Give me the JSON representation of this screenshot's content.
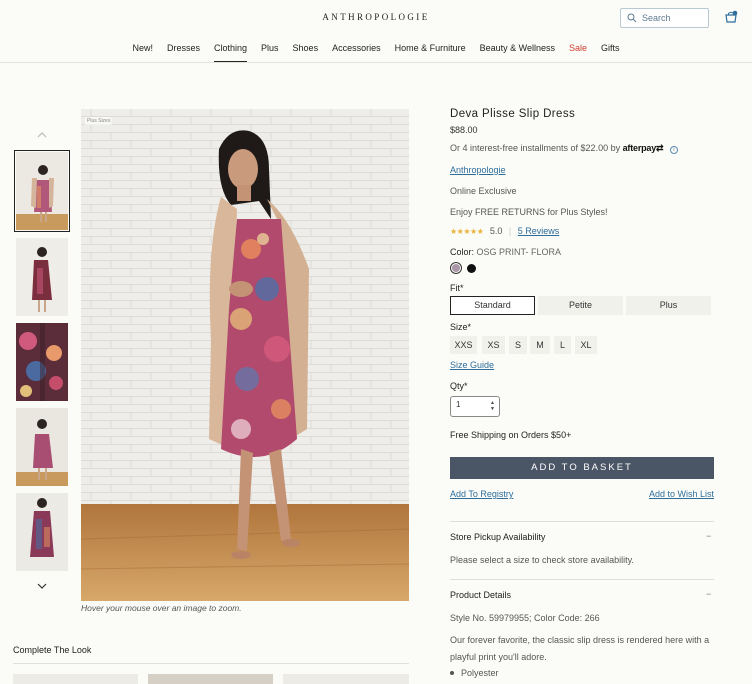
{
  "header": {
    "logo": "ANTHROPOLOGIE",
    "search_placeholder": "Search",
    "nav": [
      "New!",
      "Dresses",
      "Clothing",
      "Plus",
      "Shoes",
      "Accessories",
      "Home & Furniture",
      "Beauty & Wellness",
      "Sale",
      "Gifts"
    ],
    "active_nav": "Clothing",
    "sale_color": "#d13b33"
  },
  "gallery": {
    "badge": "Plus Sizes",
    "hover_hint": "Hover your mouse over an image to zoom."
  },
  "complete_the_look": {
    "title": "Complete The Look"
  },
  "product": {
    "title": "Deva Plisse Slip Dress",
    "price": "$88.00",
    "installments": "Or 4 interest-free installments of $22.00 by",
    "afterpay": "afterpay",
    "brand": "Anthropologie",
    "exclusive": "Online Exclusive",
    "returns": "Enjoy FREE RETURNS for Plus Styles!",
    "rating": "5.0",
    "stars": "★★★★★",
    "reviews": "5 Reviews",
    "color_label": "Color:",
    "color_value": "OSG PRINT- FLORA",
    "fit_label": "Fit*",
    "fits": [
      "Standard",
      "Petite",
      "Plus"
    ],
    "size_label": "Size*",
    "sizes": [
      "XXS",
      "XS",
      "S",
      "M",
      "L",
      "XL"
    ],
    "size_guide": "Size Guide",
    "qty_label": "Qty*",
    "qty_value": "1",
    "shipping": "Free Shipping on Orders $50+",
    "add_to_basket": "ADD TO BASKET",
    "add_to_registry": "Add To Registry",
    "add_to_wishlist": "Add to Wish List",
    "button_color": "#4a5566",
    "link_color": "#2e6e9c"
  },
  "accordions": {
    "pickup_title": "Store Pickup Availability",
    "pickup_text": "Please select a size to check store availability.",
    "details_title": "Product Details",
    "style_no": "Style No. 59979955; Color Code: 266",
    "description": "Our forever favorite, the classic slip dress is rendered here with a playful print you'll adore.",
    "bullet": "Polyester",
    "toggle": "−"
  }
}
